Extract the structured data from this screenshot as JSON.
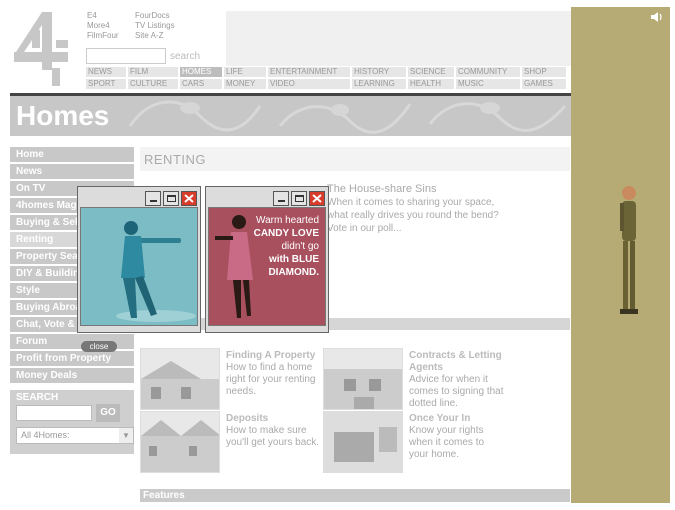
{
  "header": {
    "links_col1": [
      "E4",
      "More4",
      "FilmFour"
    ],
    "links_col2": [
      "FourDocs",
      "TV Listings",
      "Site A-Z"
    ],
    "search_label": "search",
    "nav_row1": [
      "NEWS",
      "FILM",
      "HOMES",
      "LIFE",
      "ENTERTAINMENT",
      "HISTORY",
      "SCIENCE",
      "COMMUNITY",
      "SHOP"
    ],
    "nav_row2": [
      "SPORT",
      "CULTURE",
      "CARS",
      "MONEY",
      "VIDEO",
      "",
      "LEARNING",
      "HEALTH",
      "MUSIC",
      "",
      "GAMES"
    ],
    "active_nav": "HOMES"
  },
  "banner": {
    "title": "Homes"
  },
  "sidebar": {
    "items": [
      "Home",
      "News",
      "On TV",
      "4homes Magazine",
      "Buying & Selling",
      "Renting",
      "Property Search",
      "DIY & Building",
      "Style",
      "Buying Abroad",
      "Chat, Vote & Win",
      "Forum",
      "Profit from Property",
      "Money Deals"
    ],
    "close_label": "close",
    "search_title": "SEARCH",
    "go_label": "GO",
    "select_value": "All 4Homes:"
  },
  "main": {
    "title": "RENTING",
    "feature_title": "The House-share Sins",
    "feature_text": "When it comes to sharing your space, what really drives you round the bend? Vote in our poll...",
    "cards": [
      {
        "title": "Finding A Property",
        "text": "How to find a home right for your renting needs."
      },
      {
        "title": "Contracts & Letting Agents",
        "text": "Advice for when it comes to signing that dotted line."
      },
      {
        "title": "Deposits",
        "text": "How to make sure you'll get yours back."
      },
      {
        "title": "Once Your In",
        "text": "Know your rights when it comes to your home."
      }
    ],
    "features_label": "Features"
  },
  "popup_ad": {
    "line1": "Warm hearted",
    "line2": "CANDY LOVE",
    "line3": "didn't go",
    "line4": "with BLUE",
    "line5": "DIAMOND."
  },
  "colors": {
    "ad_bg": "#b6ab75",
    "popup_blue": "#7cbcc5",
    "popup_pink": "#a8505e"
  }
}
